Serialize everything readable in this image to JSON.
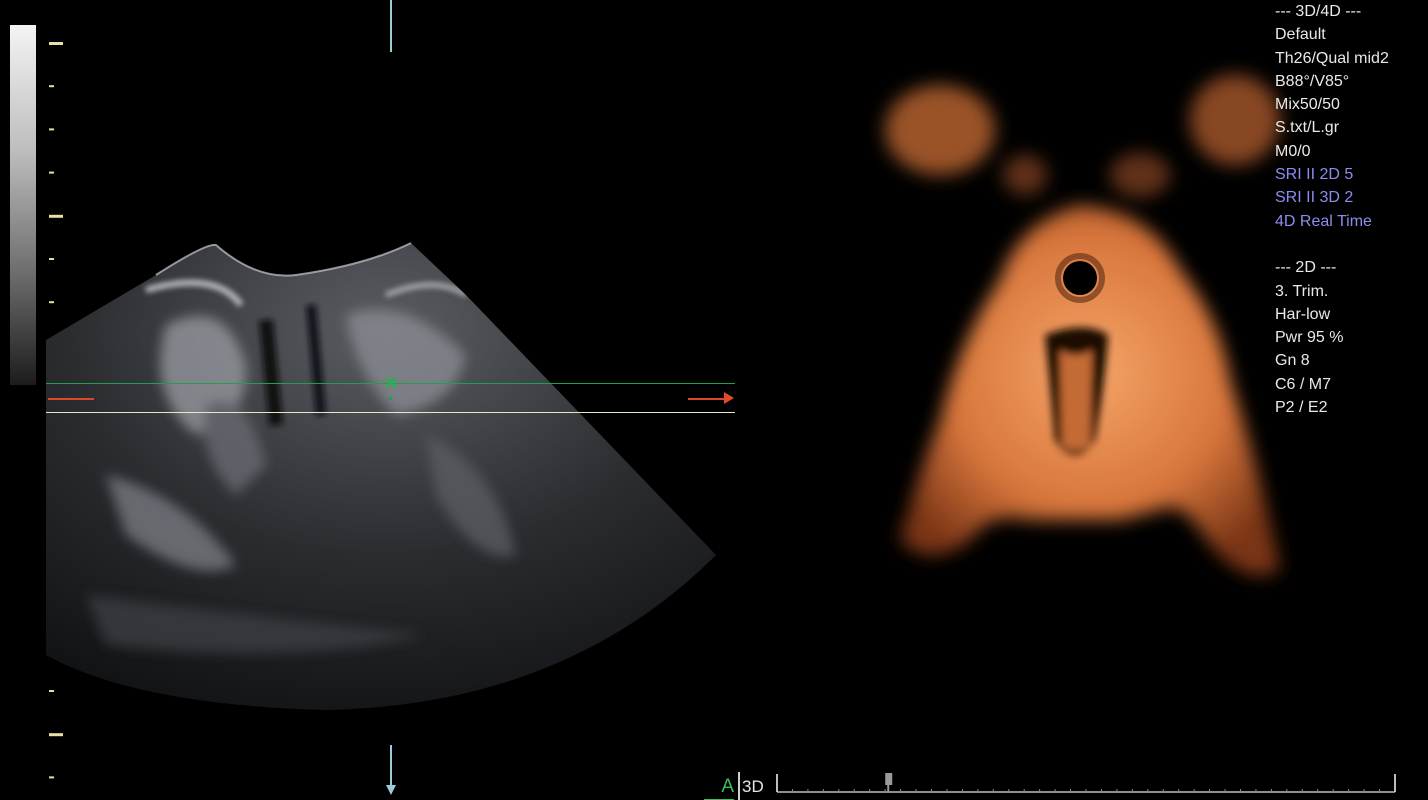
{
  "info_panel": {
    "lines_3d": [
      {
        "text": "--- 3D/4D ---",
        "color": "#e9e9e9"
      },
      {
        "text": "Default",
        "color": "#e9e9e9"
      },
      {
        "text": "Th26/Qual mid2",
        "color": "#e9e9e9"
      },
      {
        "text": "B88°/V85°",
        "color": "#e9e9e9"
      },
      {
        "text": "Mix50/50",
        "color": "#e9e9e9"
      },
      {
        "text": "S.txt/L.gr",
        "color": "#e9e9e9"
      },
      {
        "text": "M0/0",
        "color": "#e9e9e9"
      },
      {
        "text": "SRI II 2D 5",
        "color": "#8c8cf0"
      },
      {
        "text": "SRI II 3D 2",
        "color": "#8c8cf0"
      },
      {
        "text": "4D Real Time",
        "color": "#8c8cf0"
      }
    ],
    "lines_2d": [
      {
        "text": "--- 2D ---",
        "color": "#e9e9e9"
      },
      {
        "text": "3. Trim.",
        "color": "#e9e9e9"
      },
      {
        "text": "Har-low",
        "color": "#e9e9e9"
      },
      {
        "text": "Pwr  95 %",
        "color": "#e9e9e9"
      },
      {
        "text": "Gn   8",
        "color": "#e9e9e9"
      },
      {
        "text": "C6 / M7",
        "color": "#e9e9e9"
      },
      {
        "text": "P2 / E2",
        "color": "#e9e9e9"
      }
    ]
  },
  "bottom_bar": {
    "view_a_label": "A",
    "mode_label": "3D",
    "timeline_position_fraction": 0.18
  },
  "colors": {
    "reference_line": "#1aa34a",
    "slice_line": "#e8e6c8",
    "red_marker": "#d94a2a",
    "render_color": "#e8894a",
    "ruler_tick": "#e8e0a8"
  },
  "icons": {
    "center_marker": "x-cross-icon",
    "red_arrow": "arrow-right-icon",
    "bottom_arrow": "arrow-down-icon"
  }
}
